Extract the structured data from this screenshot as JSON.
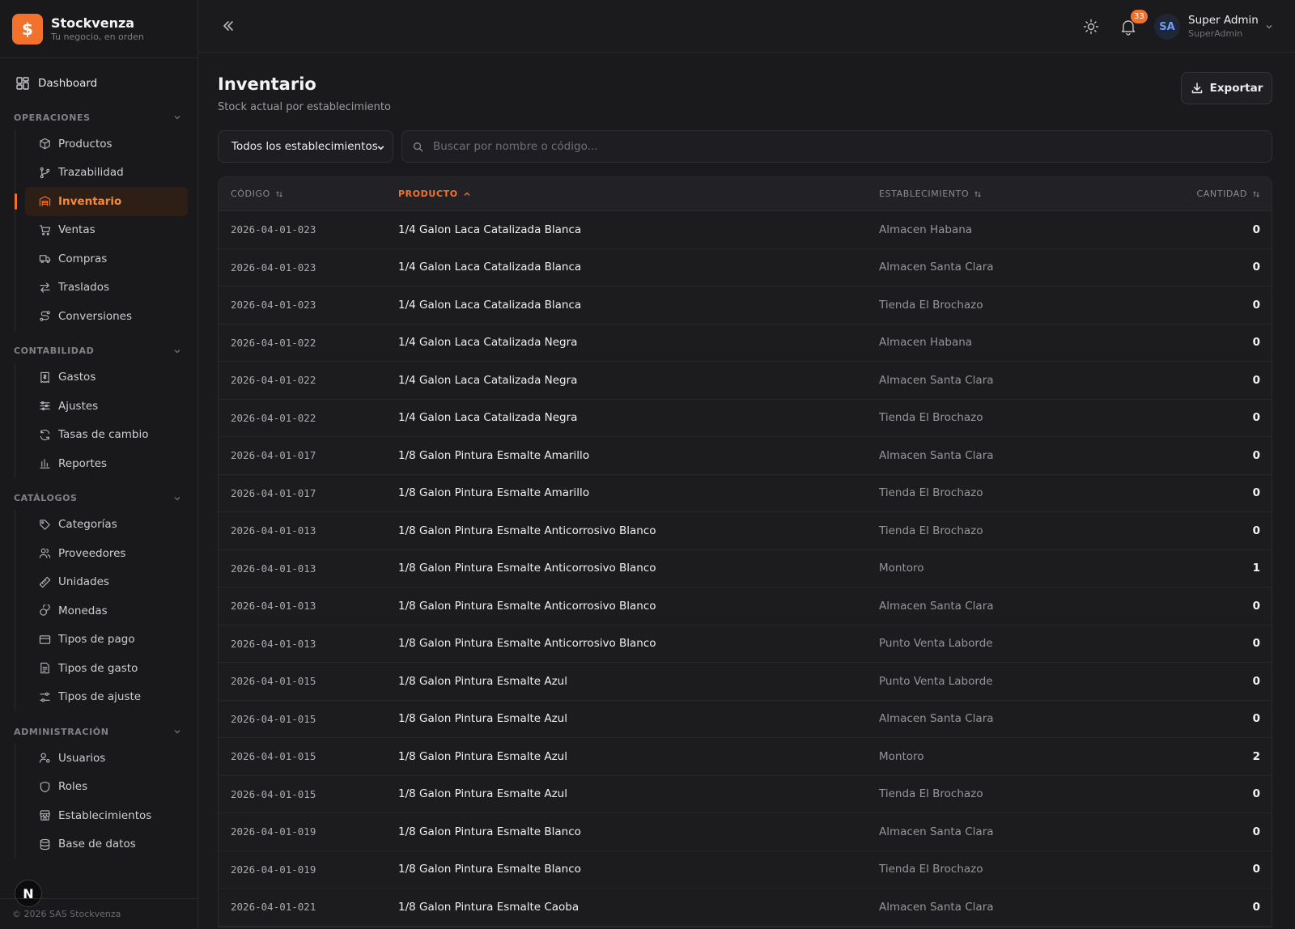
{
  "brand": {
    "logo": "$",
    "name": "Stockvenza",
    "tagline": "Tu negocio, en orden"
  },
  "nav": {
    "dashboard": "Dashboard",
    "sections": [
      {
        "title": "OPERACIONES",
        "items": [
          {
            "label": "Productos",
            "icon": "box-icon"
          },
          {
            "label": "Trazabilidad",
            "icon": "branch-icon"
          },
          {
            "label": "Inventario",
            "icon": "warehouse-icon",
            "active": true
          },
          {
            "label": "Ventas",
            "icon": "cart-icon"
          },
          {
            "label": "Compras",
            "icon": "truck-icon"
          },
          {
            "label": "Traslados",
            "icon": "arrows-icon"
          },
          {
            "label": "Conversiones",
            "icon": "route-icon"
          }
        ]
      },
      {
        "title": "CONTABILIDAD",
        "items": [
          {
            "label": "Gastos",
            "icon": "receipt-icon"
          },
          {
            "label": "Ajustes",
            "icon": "sliders-icon"
          },
          {
            "label": "Tasas de cambio",
            "icon": "refresh-icon"
          },
          {
            "label": "Reportes",
            "icon": "bar-chart-icon"
          }
        ]
      },
      {
        "title": "CATÁLOGOS",
        "items": [
          {
            "label": "Categorías",
            "icon": "tag-icon"
          },
          {
            "label": "Proveedores",
            "icon": "users-icon"
          },
          {
            "label": "Unidades",
            "icon": "ruler-icon"
          },
          {
            "label": "Monedas",
            "icon": "coins-icon"
          },
          {
            "label": "Tipos de pago",
            "icon": "card-icon"
          },
          {
            "label": "Tipos de gasto",
            "icon": "file-icon"
          },
          {
            "label": "Tipos de ajuste",
            "icon": "adjust-icon"
          }
        ]
      },
      {
        "title": "ADMINISTRACIÓN",
        "items": [
          {
            "label": "Usuarios",
            "icon": "user-cog-icon"
          },
          {
            "label": "Roles",
            "icon": "shield-icon"
          },
          {
            "label": "Establecimientos",
            "icon": "store-icon"
          },
          {
            "label": "Base de datos",
            "icon": "database-icon"
          }
        ]
      }
    ],
    "footer": "© 2026 SAS Stockvenza",
    "badge": "N"
  },
  "topbar": {
    "notifications": "33",
    "avatar": "SA",
    "user_name": "Super Admin",
    "user_role": "SuperAdmin"
  },
  "page": {
    "title": "Inventario",
    "subtitle": "Stock actual por establecimiento",
    "export_label": "Exportar",
    "filter_value": "Todos los establecimientos",
    "search_placeholder": "Buscar por nombre o código..."
  },
  "table": {
    "headers": [
      "CÓDIGO",
      "PRODUCTO",
      "ESTABLECIMIENTO",
      "CANTIDAD"
    ],
    "rows": [
      [
        "2026-04-01-023",
        "1/4 Galon Laca Catalizada Blanca",
        "Almacen Habana",
        "0"
      ],
      [
        "2026-04-01-023",
        "1/4 Galon Laca Catalizada Blanca",
        "Almacen Santa Clara",
        "0"
      ],
      [
        "2026-04-01-023",
        "1/4 Galon Laca Catalizada Blanca",
        "Tienda El Brochazo",
        "0"
      ],
      [
        "2026-04-01-022",
        "1/4 Galon Laca Catalizada Negra",
        "Almacen Habana",
        "0"
      ],
      [
        "2026-04-01-022",
        "1/4 Galon Laca Catalizada Negra",
        "Almacen Santa Clara",
        "0"
      ],
      [
        "2026-04-01-022",
        "1/4 Galon Laca Catalizada Negra",
        "Tienda El Brochazo",
        "0"
      ],
      [
        "2026-04-01-017",
        "1/8 Galon Pintura Esmalte Amarillo",
        "Almacen Santa Clara",
        "0"
      ],
      [
        "2026-04-01-017",
        "1/8 Galon Pintura Esmalte Amarillo",
        "Tienda El Brochazo",
        "0"
      ],
      [
        "2026-04-01-013",
        "1/8 Galon Pintura Esmalte Anticorrosivo Blanco",
        "Tienda El Brochazo",
        "0"
      ],
      [
        "2026-04-01-013",
        "1/8 Galon Pintura Esmalte Anticorrosivo Blanco",
        "Montoro",
        "1"
      ],
      [
        "2026-04-01-013",
        "1/8 Galon Pintura Esmalte Anticorrosivo Blanco",
        "Almacen Santa Clara",
        "0"
      ],
      [
        "2026-04-01-013",
        "1/8 Galon Pintura Esmalte Anticorrosivo Blanco",
        "Punto Venta Laborde",
        "0"
      ],
      [
        "2026-04-01-015",
        "1/8 Galon Pintura Esmalte Azul",
        "Punto Venta Laborde",
        "0"
      ],
      [
        "2026-04-01-015",
        "1/8 Galon Pintura Esmalte Azul",
        "Almacen Santa Clara",
        "0"
      ],
      [
        "2026-04-01-015",
        "1/8 Galon Pintura Esmalte Azul",
        "Montoro",
        "2"
      ],
      [
        "2026-04-01-015",
        "1/8 Galon Pintura Esmalte Azul",
        "Tienda El Brochazo",
        "0"
      ],
      [
        "2026-04-01-019",
        "1/8 Galon Pintura Esmalte Blanco",
        "Almacen Santa Clara",
        "0"
      ],
      [
        "2026-04-01-019",
        "1/8 Galon Pintura Esmalte Blanco",
        "Tienda El Brochazo",
        "0"
      ],
      [
        "2026-04-01-021",
        "1/8 Galon Pintura Esmalte Caoba",
        "Almacen Santa Clara",
        "0"
      ]
    ]
  },
  "colors": {
    "accent": "#f2722b",
    "background": "#1a1a1d"
  }
}
